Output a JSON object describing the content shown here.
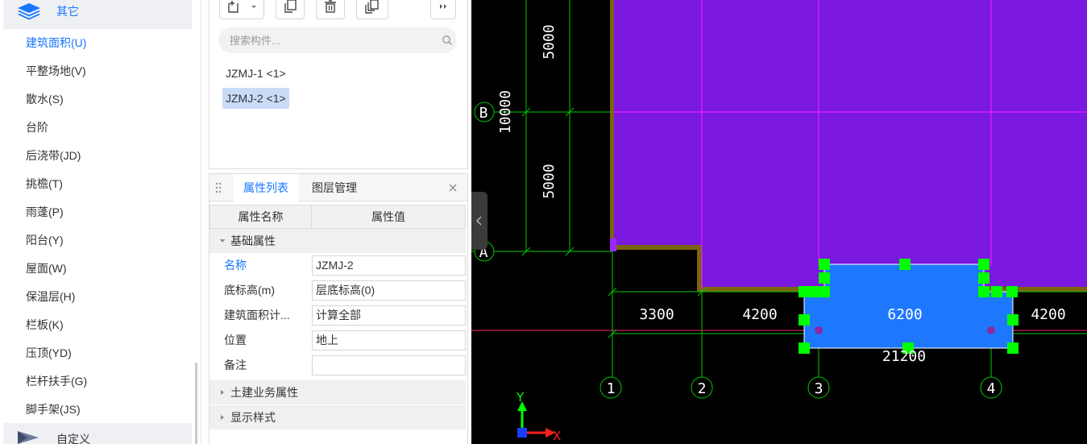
{
  "category_tree": {
    "current_category": {
      "label": "其它",
      "icon": "layers-icon"
    },
    "items": [
      {
        "label": "建筑面积(U)",
        "active": true
      },
      {
        "label": "平整场地(V)",
        "active": false
      },
      {
        "label": "散水(S)",
        "active": false
      },
      {
        "label": "台阶",
        "active": false
      },
      {
        "label": "后浇带(JD)",
        "active": false
      },
      {
        "label": "挑檐(T)",
        "active": false
      },
      {
        "label": "雨蓬(P)",
        "active": false
      },
      {
        "label": "阳台(Y)",
        "active": false
      },
      {
        "label": "屋面(W)",
        "active": false
      },
      {
        "label": "保温层(H)",
        "active": false
      },
      {
        "label": "栏板(K)",
        "active": false
      },
      {
        "label": "压顶(YD)",
        "active": false
      },
      {
        "label": "栏杆扶手(G)",
        "active": false
      },
      {
        "label": "脚手架(JS)",
        "active": false
      }
    ],
    "next_category": {
      "label": "自定义",
      "icon": "custom-icon"
    }
  },
  "component_list": {
    "toolbar": [
      "new-icon",
      "dropdown-arrow-icon",
      "copy-icon",
      "delete-icon",
      "copy-to-floor-icon",
      "more-icon"
    ],
    "search": {
      "placeholder": "搜索构件...",
      "value": ""
    },
    "items": [
      {
        "label": "JZMJ-1 <1>",
        "selected": false
      },
      {
        "label": "JZMJ-2 <1>",
        "selected": true
      }
    ]
  },
  "property_panel": {
    "tabs": [
      {
        "label": "属性列表",
        "active": true
      },
      {
        "label": "图层管理",
        "active": false
      }
    ],
    "columns": {
      "name": "属性名称",
      "value": "属性值"
    },
    "group_basic": {
      "label": "基础属性",
      "expanded": true
    },
    "rows": [
      {
        "name": "名称",
        "value": "JZMJ-2",
        "highlight": true
      },
      {
        "name": "底标高(m)",
        "value": "层底标高(0)",
        "highlight": false
      },
      {
        "name": "建筑面积计...",
        "value": "计算全部",
        "highlight": false
      },
      {
        "name": "位置",
        "value": "地上",
        "highlight": false
      },
      {
        "name": "备注",
        "value": "",
        "highlight": false
      }
    ],
    "group_civil": {
      "label": "土建业务属性",
      "expanded": false
    },
    "group_display": {
      "label": "显示样式",
      "expanded": false
    }
  },
  "cad_view": {
    "colors": {
      "background": "#000000",
      "building": "#7a18e0",
      "grid_line": "#ff20ff",
      "dimension_line": "#00c800",
      "dimension_text": "#ffffff",
      "wall": "#7a6410",
      "selected_region": "#1e78ff",
      "grip": "#00ff00"
    },
    "axis_labels_vertical": [
      "B",
      "A"
    ],
    "axis_labels_horizontal": [
      "1",
      "2",
      "3",
      "4"
    ],
    "vertical_dimensions": [
      "5000",
      "10000",
      "5000"
    ],
    "horizontal_dimensions": [
      "3300",
      "4200",
      "6200",
      "4200"
    ],
    "total_dimension": "21200",
    "ucs": {
      "y_label": "Y",
      "x_label": "X"
    }
  }
}
